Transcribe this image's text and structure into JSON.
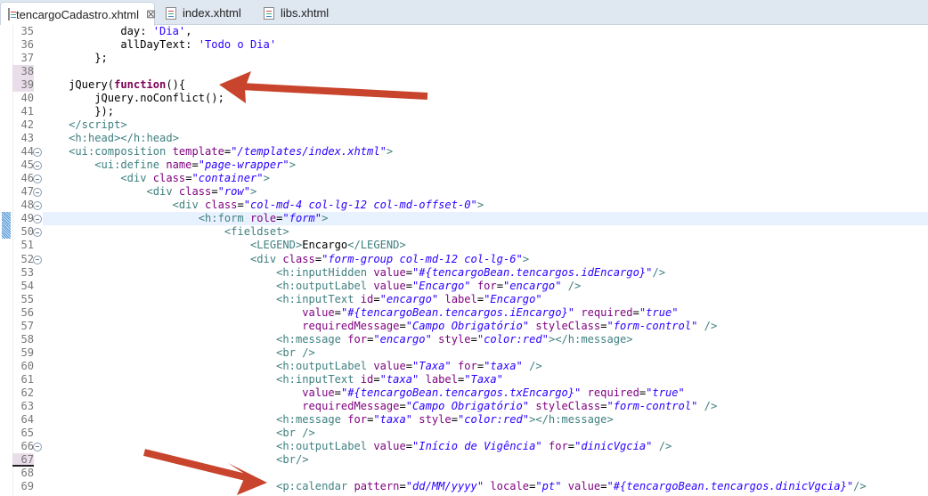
{
  "tabs": [
    {
      "label": "tencargoCadastro.xhtml",
      "active": true,
      "close": "⊠"
    },
    {
      "label": "index.xhtml"
    },
    {
      "label": "libs.xhtml"
    }
  ],
  "colors": {
    "arrow": "#c8442c",
    "tag": "#3f7f7f",
    "attr": "#7f007f",
    "value": "#2a00ff"
  },
  "lines": [
    {
      "n": "35",
      "tokens": [
        [
          "x",
          "            day: "
        ],
        [
          "s",
          "'Dia'"
        ],
        [
          "x",
          ","
        ]
      ]
    },
    {
      "n": "36",
      "tokens": [
        [
          "x",
          "            allDayText: "
        ],
        [
          "s",
          "'Todo o Dia'"
        ]
      ]
    },
    {
      "n": "37",
      "tokens": [
        [
          "x",
          "        };"
        ]
      ]
    },
    {
      "n": "38",
      "mark": true,
      "tokens": []
    },
    {
      "n": "39",
      "mark": true,
      "tokens": [
        [
          "x",
          "    jQuery("
        ],
        [
          "k",
          "function"
        ],
        [
          "x",
          "(){"
        ]
      ]
    },
    {
      "n": "40",
      "tokens": [
        [
          "x",
          "        jQuery.noConflict();"
        ]
      ]
    },
    {
      "n": "41",
      "tokens": [
        [
          "x",
          "        });"
        ]
      ]
    },
    {
      "n": "42",
      "tokens": [
        [
          "t",
          "    </script>"
        ]
      ]
    },
    {
      "n": "43",
      "tokens": [
        [
          "t",
          "    <h:head></h:head>"
        ]
      ]
    },
    {
      "n": "44",
      "fold": true,
      "tokens": [
        [
          "t",
          "    <ui:composition "
        ],
        [
          "a",
          "template"
        ],
        [
          "x",
          "="
        ],
        [
          "v",
          "\"/templates/index.xhtml\""
        ],
        [
          "t",
          ">"
        ]
      ]
    },
    {
      "n": "45",
      "fold": true,
      "tokens": [
        [
          "t",
          "        <ui:define "
        ],
        [
          "a",
          "name"
        ],
        [
          "x",
          "="
        ],
        [
          "v",
          "\"page-wrapper\""
        ],
        [
          "t",
          ">"
        ]
      ]
    },
    {
      "n": "46",
      "fold": true,
      "tokens": [
        [
          "t",
          "            <div "
        ],
        [
          "a",
          "class"
        ],
        [
          "x",
          "="
        ],
        [
          "v",
          "\"container\""
        ],
        [
          "t",
          ">"
        ]
      ]
    },
    {
      "n": "47",
      "fold": true,
      "tokens": [
        [
          "t",
          "                <div "
        ],
        [
          "a",
          "class"
        ],
        [
          "x",
          "="
        ],
        [
          "v",
          "\"row\""
        ],
        [
          "t",
          ">"
        ]
      ]
    },
    {
      "n": "48",
      "fold": true,
      "tokens": [
        [
          "t",
          "                    <div "
        ],
        [
          "a",
          "class"
        ],
        [
          "x",
          "="
        ],
        [
          "v",
          "\"col-md-4 col-lg-12 col-md-offset-0\""
        ],
        [
          "t",
          ">"
        ]
      ]
    },
    {
      "n": "49",
      "fold": true,
      "current": true,
      "hatch": true,
      "tokens": [
        [
          "t",
          "                        <h:form "
        ],
        [
          "a",
          "role"
        ],
        [
          "x",
          "="
        ],
        [
          "v",
          "\"form\""
        ],
        [
          "t",
          ">"
        ]
      ]
    },
    {
      "n": "50",
      "fold": true,
      "hatch": true,
      "tokens": [
        [
          "t",
          "                            <fieldset>"
        ]
      ]
    },
    {
      "n": "51",
      "tokens": [
        [
          "t",
          "                                <LEGEND>"
        ],
        [
          "x",
          "Encargo"
        ],
        [
          "t",
          "</LEGEND>"
        ]
      ]
    },
    {
      "n": "52",
      "fold": true,
      "tokens": [
        [
          "t",
          "                                <div "
        ],
        [
          "a",
          "class"
        ],
        [
          "x",
          "="
        ],
        [
          "v",
          "\"form-group col-md-12 col-lg-6\""
        ],
        [
          "t",
          ">"
        ]
      ]
    },
    {
      "n": "53",
      "tokens": [
        [
          "t",
          "                                    <h:inputHidden "
        ],
        [
          "a",
          "value"
        ],
        [
          "x",
          "="
        ],
        [
          "v",
          "\"#{tencargoBean.tencargos.idEncargo}\""
        ],
        [
          "t",
          "/>"
        ]
      ]
    },
    {
      "n": "54",
      "tokens": [
        [
          "t",
          "                                    <h:outputLabel "
        ],
        [
          "a",
          "value"
        ],
        [
          "x",
          "="
        ],
        [
          "v",
          "\"Encargo\""
        ],
        [
          "a",
          " for"
        ],
        [
          "x",
          "="
        ],
        [
          "v",
          "\"encargo\""
        ],
        [
          "t",
          " />"
        ]
      ]
    },
    {
      "n": "55",
      "tokens": [
        [
          "t",
          "                                    <h:inputText "
        ],
        [
          "a",
          "id"
        ],
        [
          "x",
          "="
        ],
        [
          "v",
          "\"encargo\""
        ],
        [
          "a",
          " label"
        ],
        [
          "x",
          "="
        ],
        [
          "v",
          "\"Encargo\""
        ]
      ]
    },
    {
      "n": "56",
      "tokens": [
        [
          "a",
          "                                        value"
        ],
        [
          "x",
          "="
        ],
        [
          "v",
          "\"#{tencargoBean.tencargos.iEncargo}\""
        ],
        [
          "a",
          " required"
        ],
        [
          "x",
          "="
        ],
        [
          "v",
          "\"true\""
        ]
      ]
    },
    {
      "n": "57",
      "tokens": [
        [
          "a",
          "                                        requiredMessage"
        ],
        [
          "x",
          "="
        ],
        [
          "v",
          "\"Campo Obrigatório\""
        ],
        [
          "a",
          " styleClass"
        ],
        [
          "x",
          "="
        ],
        [
          "v",
          "\"form-control\""
        ],
        [
          "t",
          " />"
        ]
      ]
    },
    {
      "n": "58",
      "tokens": [
        [
          "t",
          "                                    <h:message "
        ],
        [
          "a",
          "for"
        ],
        [
          "x",
          "="
        ],
        [
          "v",
          "\"encargo\""
        ],
        [
          "a",
          " style"
        ],
        [
          "x",
          "="
        ],
        [
          "v",
          "\"color:red\""
        ],
        [
          "t",
          "></h:message>"
        ]
      ]
    },
    {
      "n": "59",
      "tokens": [
        [
          "t",
          "                                    <br />"
        ]
      ]
    },
    {
      "n": "60",
      "tokens": [
        [
          "t",
          "                                    <h:outputLabel "
        ],
        [
          "a",
          "value"
        ],
        [
          "x",
          "="
        ],
        [
          "v",
          "\"Taxa\""
        ],
        [
          "a",
          " for"
        ],
        [
          "x",
          "="
        ],
        [
          "v",
          "\"taxa\""
        ],
        [
          "t",
          " />"
        ]
      ]
    },
    {
      "n": "61",
      "tokens": [
        [
          "t",
          "                                    <h:inputText "
        ],
        [
          "a",
          "id"
        ],
        [
          "x",
          "="
        ],
        [
          "v",
          "\"taxa\""
        ],
        [
          "a",
          " label"
        ],
        [
          "x",
          "="
        ],
        [
          "v",
          "\"Taxa\""
        ]
      ]
    },
    {
      "n": "62",
      "tokens": [
        [
          "a",
          "                                        value"
        ],
        [
          "x",
          "="
        ],
        [
          "v",
          "\"#{tencargoBean.tencargos.txEncargo}\""
        ],
        [
          "a",
          " required"
        ],
        [
          "x",
          "="
        ],
        [
          "v",
          "\"true\""
        ]
      ]
    },
    {
      "n": "63",
      "tokens": [
        [
          "a",
          "                                        requiredMessage"
        ],
        [
          "x",
          "="
        ],
        [
          "v",
          "\"Campo Obrigatório\""
        ],
        [
          "a",
          " styleClass"
        ],
        [
          "x",
          "="
        ],
        [
          "v",
          "\"form-control\""
        ],
        [
          "t",
          " />"
        ]
      ]
    },
    {
      "n": "64",
      "tokens": [
        [
          "t",
          "                                    <h:message "
        ],
        [
          "a",
          "for"
        ],
        [
          "x",
          "="
        ],
        [
          "v",
          "\"taxa\""
        ],
        [
          "a",
          " style"
        ],
        [
          "x",
          "="
        ],
        [
          "v",
          "\"color:red\""
        ],
        [
          "t",
          "></h:message>"
        ]
      ]
    },
    {
      "n": "65",
      "tokens": [
        [
          "t",
          "                                    <br />"
        ]
      ]
    },
    {
      "n": "66",
      "fold": true,
      "tokens": [
        [
          "t",
          "                                    <h:outputLabel "
        ],
        [
          "a",
          "value"
        ],
        [
          "x",
          "="
        ],
        [
          "v",
          "\"Início de Vigência\""
        ],
        [
          "a",
          " for"
        ],
        [
          "x",
          "="
        ],
        [
          "v",
          "\"dinicVgcia\""
        ],
        [
          "t",
          " />"
        ]
      ]
    },
    {
      "n": "67",
      "mark": true,
      "underline": true,
      "tokens": [
        [
          "t",
          "                                    <br/>"
        ]
      ]
    },
    {
      "n": "68",
      "tokens": []
    },
    {
      "n": "69",
      "tokens": [
        [
          "t",
          "                                    <p:calendar "
        ],
        [
          "a",
          "pattern"
        ],
        [
          "x",
          "="
        ],
        [
          "v",
          "\"dd/MM/yyyy\""
        ],
        [
          "a",
          " locale"
        ],
        [
          "x",
          "="
        ],
        [
          "v",
          "\"pt\""
        ],
        [
          "a",
          " value"
        ],
        [
          "x",
          "="
        ],
        [
          "v",
          "\"#{tencargoBean.tencargos.dinicVgcia}\""
        ],
        [
          "t",
          "/>"
        ]
      ]
    }
  ]
}
